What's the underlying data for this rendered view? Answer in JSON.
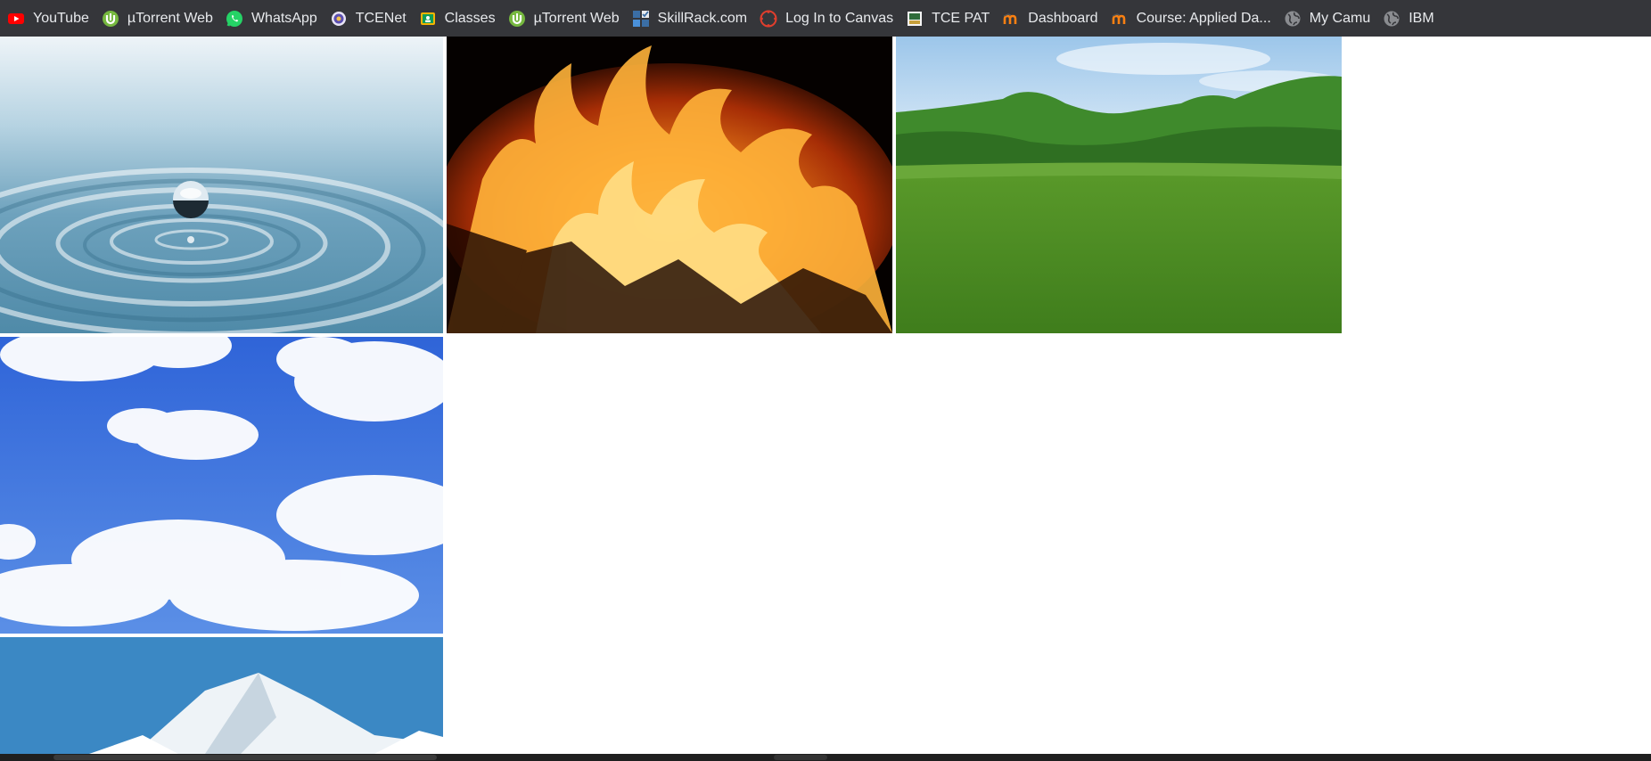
{
  "bookmarks": [
    {
      "label": "YouTube",
      "icon": "youtube-icon"
    },
    {
      "label": "µTorrent Web",
      "icon": "utorrent-icon"
    },
    {
      "label": "WhatsApp",
      "icon": "whatsapp-icon"
    },
    {
      "label": "TCENet",
      "icon": "tcenet-icon"
    },
    {
      "label": "Classes",
      "icon": "classes-icon"
    },
    {
      "label": "µTorrent Web",
      "icon": "utorrent-icon"
    },
    {
      "label": "SkillRack.com",
      "icon": "skillrack-icon"
    },
    {
      "label": "Log In to Canvas",
      "icon": "canvas-icon"
    },
    {
      "label": "TCE PAT",
      "icon": "tce-pat-icon"
    },
    {
      "label": "Dashboard",
      "icon": "moodle-icon"
    },
    {
      "label": "Course: Applied Da...",
      "icon": "moodle-icon"
    },
    {
      "label": "My Camu",
      "icon": "globe-icon"
    },
    {
      "label": "IBM",
      "icon": "globe-icon"
    }
  ],
  "gallery": {
    "images": [
      {
        "subject": "water-drop"
      },
      {
        "subject": "fire"
      },
      {
        "subject": "grass-field-hills"
      },
      {
        "subject": "blue-sky-clouds"
      },
      {
        "subject": "snowy-mountain"
      }
    ]
  },
  "colors": {
    "bookmark_bar": "#35363a",
    "bookmark_text": "#e8eaed",
    "page_background": "#ffffff"
  }
}
